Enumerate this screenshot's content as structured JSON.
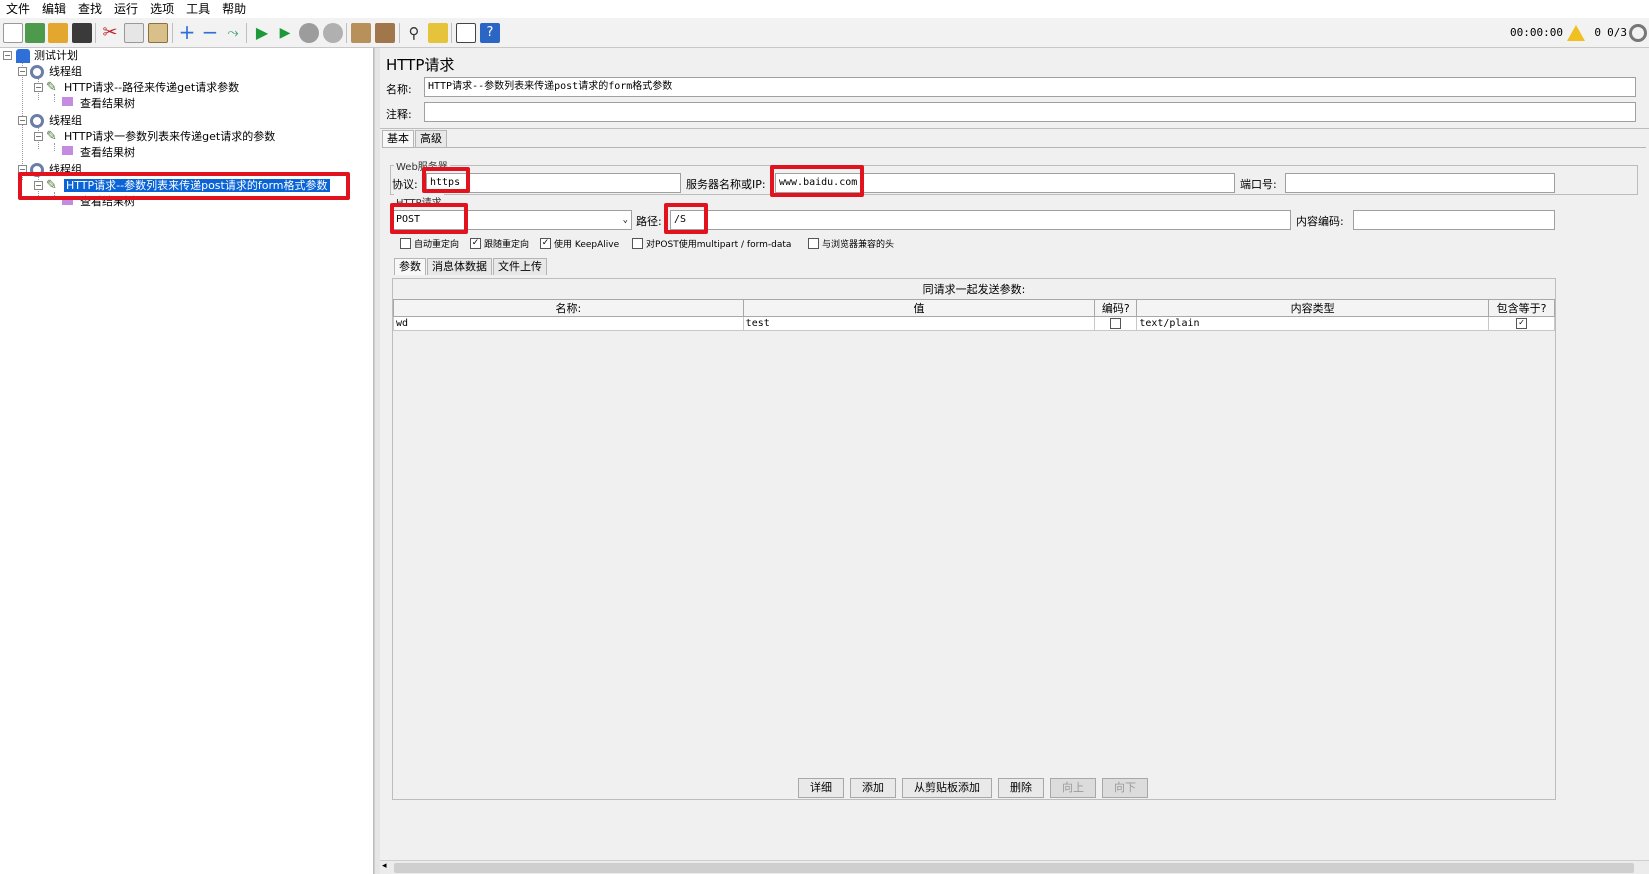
{
  "menubar": {
    "items": [
      "文件",
      "编辑",
      "查找",
      "运行",
      "选项",
      "工具",
      "帮助"
    ]
  },
  "toolbar": {
    "icons": [
      "new-icon",
      "templates-icon",
      "open-icon",
      "save-icon",
      "cut-icon",
      "copy-icon",
      "paste-icon",
      "expand-icon",
      "collapse-icon",
      "toggle-icon",
      "start-icon",
      "start-no-pause-icon",
      "stop-icon",
      "shutdown-icon",
      "clear-icon",
      "clear-all-icon",
      "search-icon",
      "reset-search-icon",
      "function-helper-icon",
      "help-icon"
    ],
    "timer": "00:00:00",
    "warnings": "0",
    "threads": "0/3"
  },
  "tree": {
    "root": "测试计划",
    "thread_group_1": "线程组",
    "sampler_1": "HTTP请求--路径来传递get请求参数",
    "listener_1": "查看结果树",
    "thread_group_2": "线程组",
    "sampler_2": "HTTP请求一参数列表来传递get请求的参数",
    "listener_2": "查看结果树",
    "thread_group_3": "线程组",
    "sampler_3": "HTTP请求--参数列表来传递post请求的form格式参数",
    "listener_3": "查看结果树"
  },
  "panel": {
    "title": "HTTP请求",
    "name_label": "名称:",
    "name_value": "HTTP请求--参数列表来传递post请求的form格式参数",
    "comment_label": "注释:",
    "comment_value": "",
    "tabs": [
      "基本",
      "高级"
    ],
    "web_server_title": "Web服务器",
    "protocol_label": "协议:",
    "protocol_value": "https",
    "server_label": "服务器名称或IP:",
    "server_value": "www.baidu.com",
    "port_label": "端口号:",
    "port_value": "",
    "http_request_title": "HTTP请求",
    "method_value": "POST",
    "path_label": "路径:",
    "path_value": "/S",
    "encoding_label": "内容编码:",
    "encoding_value": "",
    "checkboxes": {
      "auto_redirect": "自动重定向",
      "follow_redirect": "跟随重定向",
      "keepalive": "使用 KeepAlive",
      "multipart": "对POST使用multipart / form-data",
      "browser_headers": "与浏览器兼容的头"
    },
    "sub_tabs": [
      "参数",
      "消息体数据",
      "文件上传"
    ],
    "params_caption": "同请求一起发送参数:",
    "params_columns": [
      "名称:",
      "值",
      "编码?",
      "内容类型",
      "包含等于?"
    ],
    "params_rows": [
      {
        "name": "wd",
        "value": "test",
        "content_type": "text/plain"
      }
    ],
    "buttons": {
      "detail": "详细",
      "add": "添加",
      "add_clipboard": "从剪贴板添加",
      "delete": "删除",
      "up": "向上",
      "down": "向下"
    }
  },
  "colors": {
    "highlight": "#e0131f",
    "selection": "#0a64d6"
  }
}
